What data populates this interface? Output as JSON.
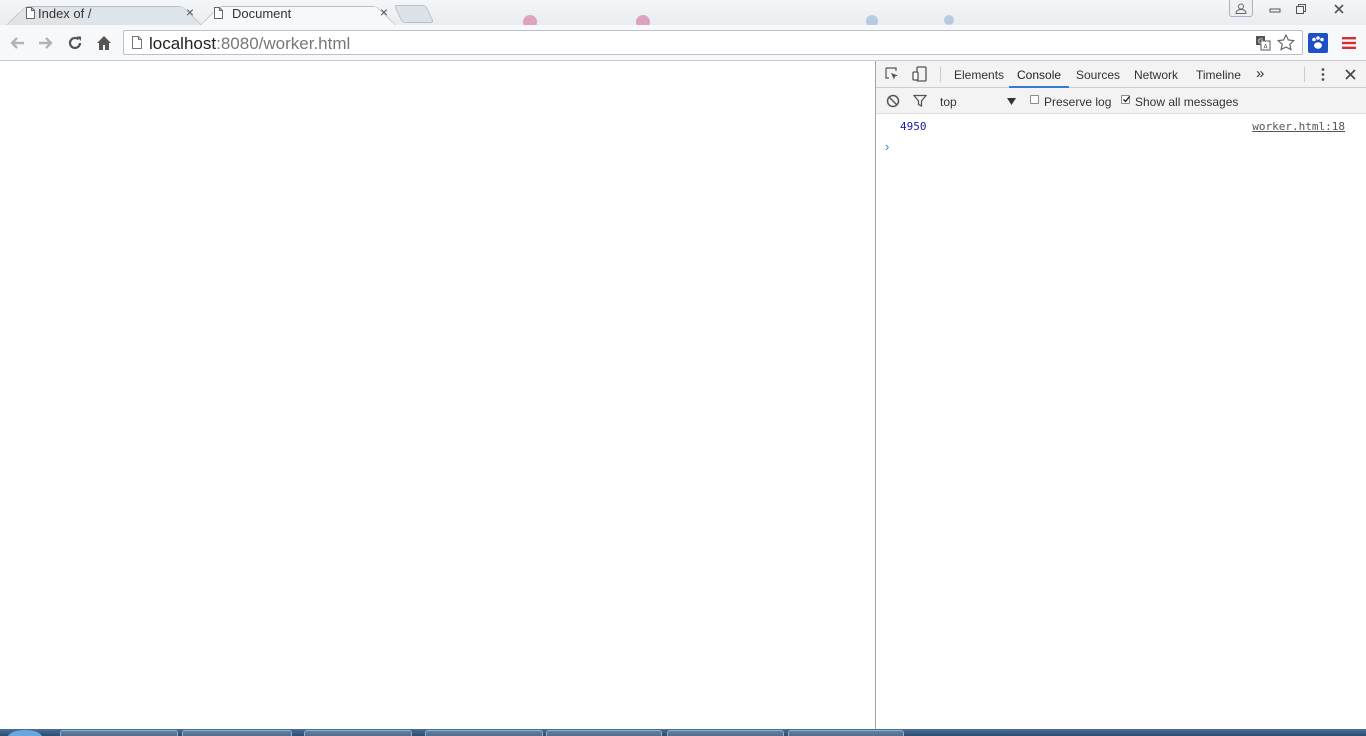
{
  "browser": {
    "tabs": [
      {
        "label": "Index of /",
        "icon": "document-icon",
        "close_icon": "close-icon",
        "active": false
      },
      {
        "label": "Document",
        "icon": "document-icon",
        "close_icon": "close-icon",
        "active": true
      }
    ],
    "address_bar": {
      "host": "localhost",
      "rest": ":8080/worker.html"
    },
    "toolbar_icons": [
      "back-icon",
      "forward-icon",
      "reload-icon",
      "home-icon",
      "page-icon",
      "translate-icon",
      "star-icon",
      "extension-paw-icon",
      "menu-icon"
    ],
    "window_controls": [
      "user-icon",
      "minimize-icon",
      "restore-icon",
      "close-icon"
    ]
  },
  "devtools": {
    "tabs": [
      "Elements",
      "Console",
      "Sources",
      "Network",
      "Timeline"
    ],
    "selected_tab": "Console",
    "more_tabs_glyph": "»",
    "context": "top",
    "preserve_log": {
      "label": "Preserve log",
      "checked": false
    },
    "show_all_messages": {
      "label": "Show all messages",
      "checked": true
    },
    "console": {
      "messages": [
        {
          "value": "4950",
          "source": "worker.html:18"
        }
      ],
      "prompt": "›"
    }
  },
  "colors": {
    "accent": "#3879d9",
    "log_number": "#1a1aa6",
    "menu_red": "#d32f2f"
  }
}
